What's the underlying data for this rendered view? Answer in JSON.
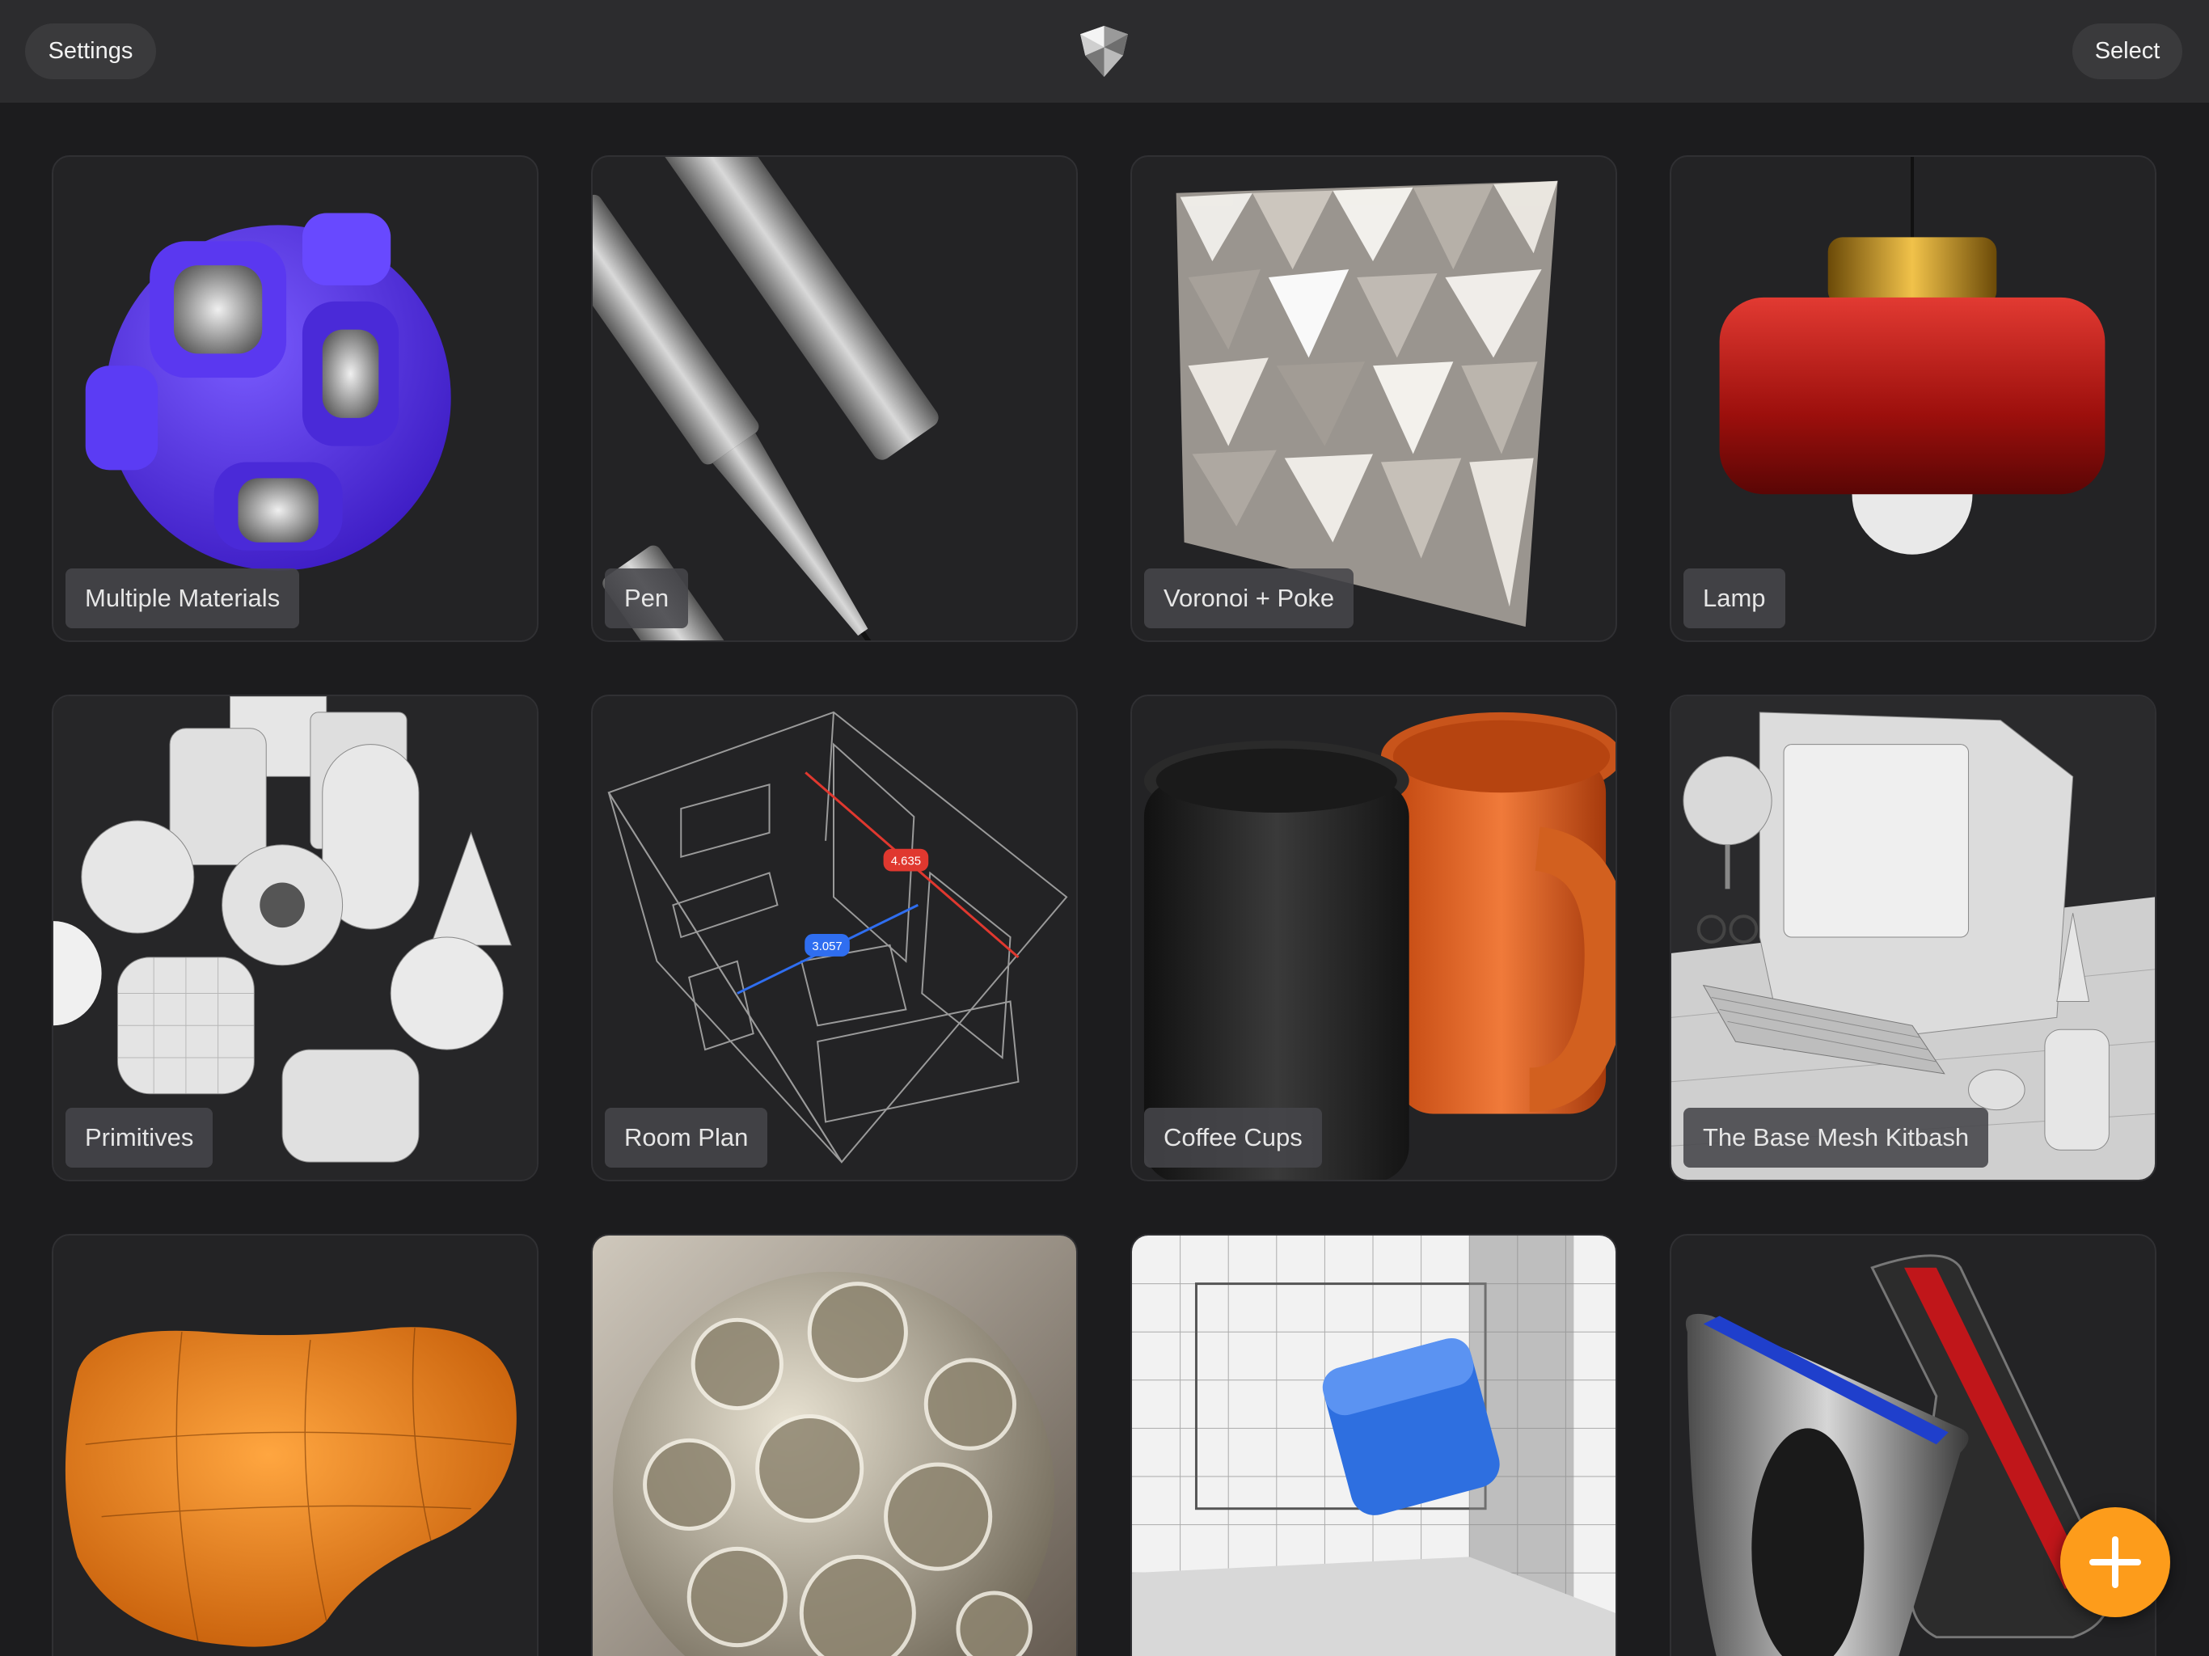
{
  "header": {
    "settings_label": "Settings",
    "select_label": "Select",
    "logo_icon": "app-logo-icon"
  },
  "projects": [
    {
      "title": "Multiple Materials",
      "thumb": "purple-lattice-ball"
    },
    {
      "title": "Pen",
      "thumb": "metal-pen"
    },
    {
      "title": "Voronoi + Poke",
      "thumb": "faceted-panel"
    },
    {
      "title": "Lamp",
      "thumb": "pendant-lamp"
    },
    {
      "title": "Primitives",
      "thumb": "wireframe-primitives"
    },
    {
      "title": "Room Plan",
      "thumb": "room-wireframe",
      "measurements": [
        "4.635",
        "3.057"
      ]
    },
    {
      "title": "Coffee Cups",
      "thumb": "coffee-mugs"
    },
    {
      "title": "The Base Mesh Kitbash",
      "thumb": "desk-computer-scene"
    },
    {
      "title": "",
      "thumb": "orange-pillow"
    },
    {
      "title": "",
      "thumb": "dimpled-sphere"
    },
    {
      "title": "",
      "thumb": "scanned-room-cube"
    },
    {
      "title": "",
      "thumb": "metal-rings"
    }
  ],
  "fab": {
    "icon": "plus-icon"
  },
  "colors": {
    "accent": "#fd9c1b",
    "background": "#1c1c1e",
    "topbar": "#2c2c2e"
  }
}
